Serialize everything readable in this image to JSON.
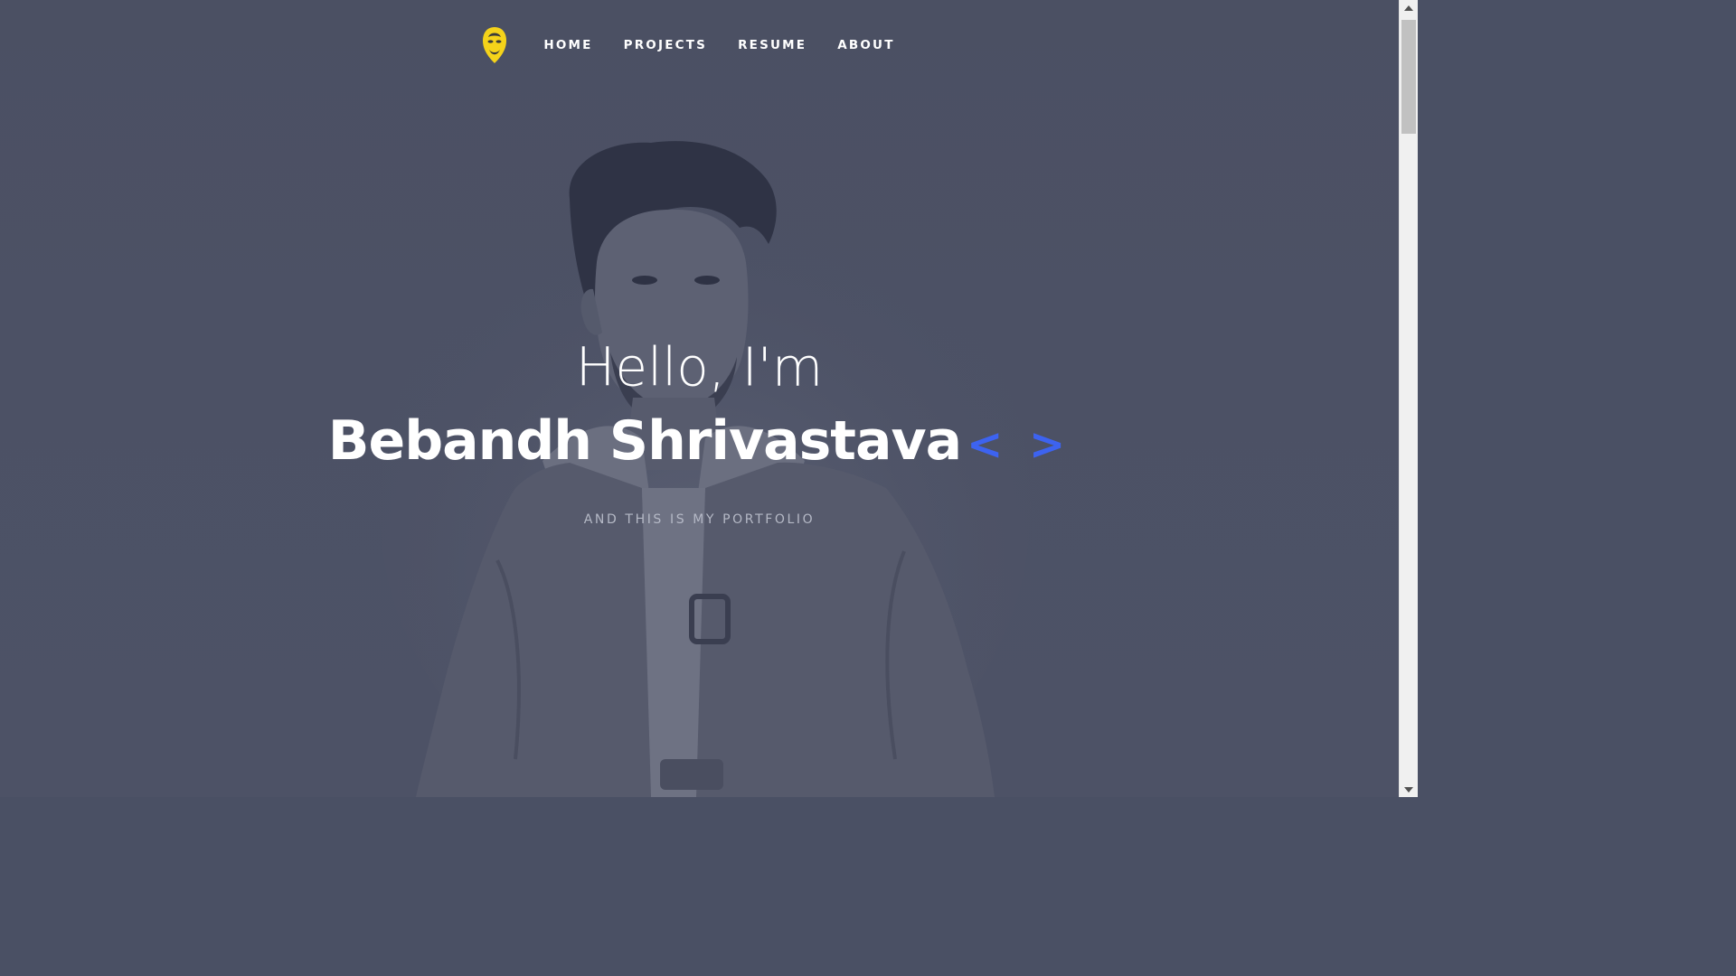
{
  "nav": {
    "logo_icon": "avatar-logo-icon",
    "items": [
      {
        "label": "HOME"
      },
      {
        "label": "PROJECTS"
      },
      {
        "label": "RESUME"
      },
      {
        "label": "ABOUT"
      }
    ]
  },
  "hero": {
    "greeting": "Hello, I'm",
    "name": "Bebandh Shrivastava",
    "code_symbol": "< >",
    "tagline": "AND THIS IS MY PORTFOLIO",
    "photo_icon": "portrait-photo"
  },
  "colors": {
    "background": "#4b5063",
    "accent": "#3d63f0",
    "logo": "#f5d31a",
    "text": "#ffffff",
    "tagline": "#b5b9c6"
  },
  "scrollbar": {
    "up_icon": "scroll-up-arrow-icon",
    "down_icon": "scroll-down-arrow-icon"
  }
}
